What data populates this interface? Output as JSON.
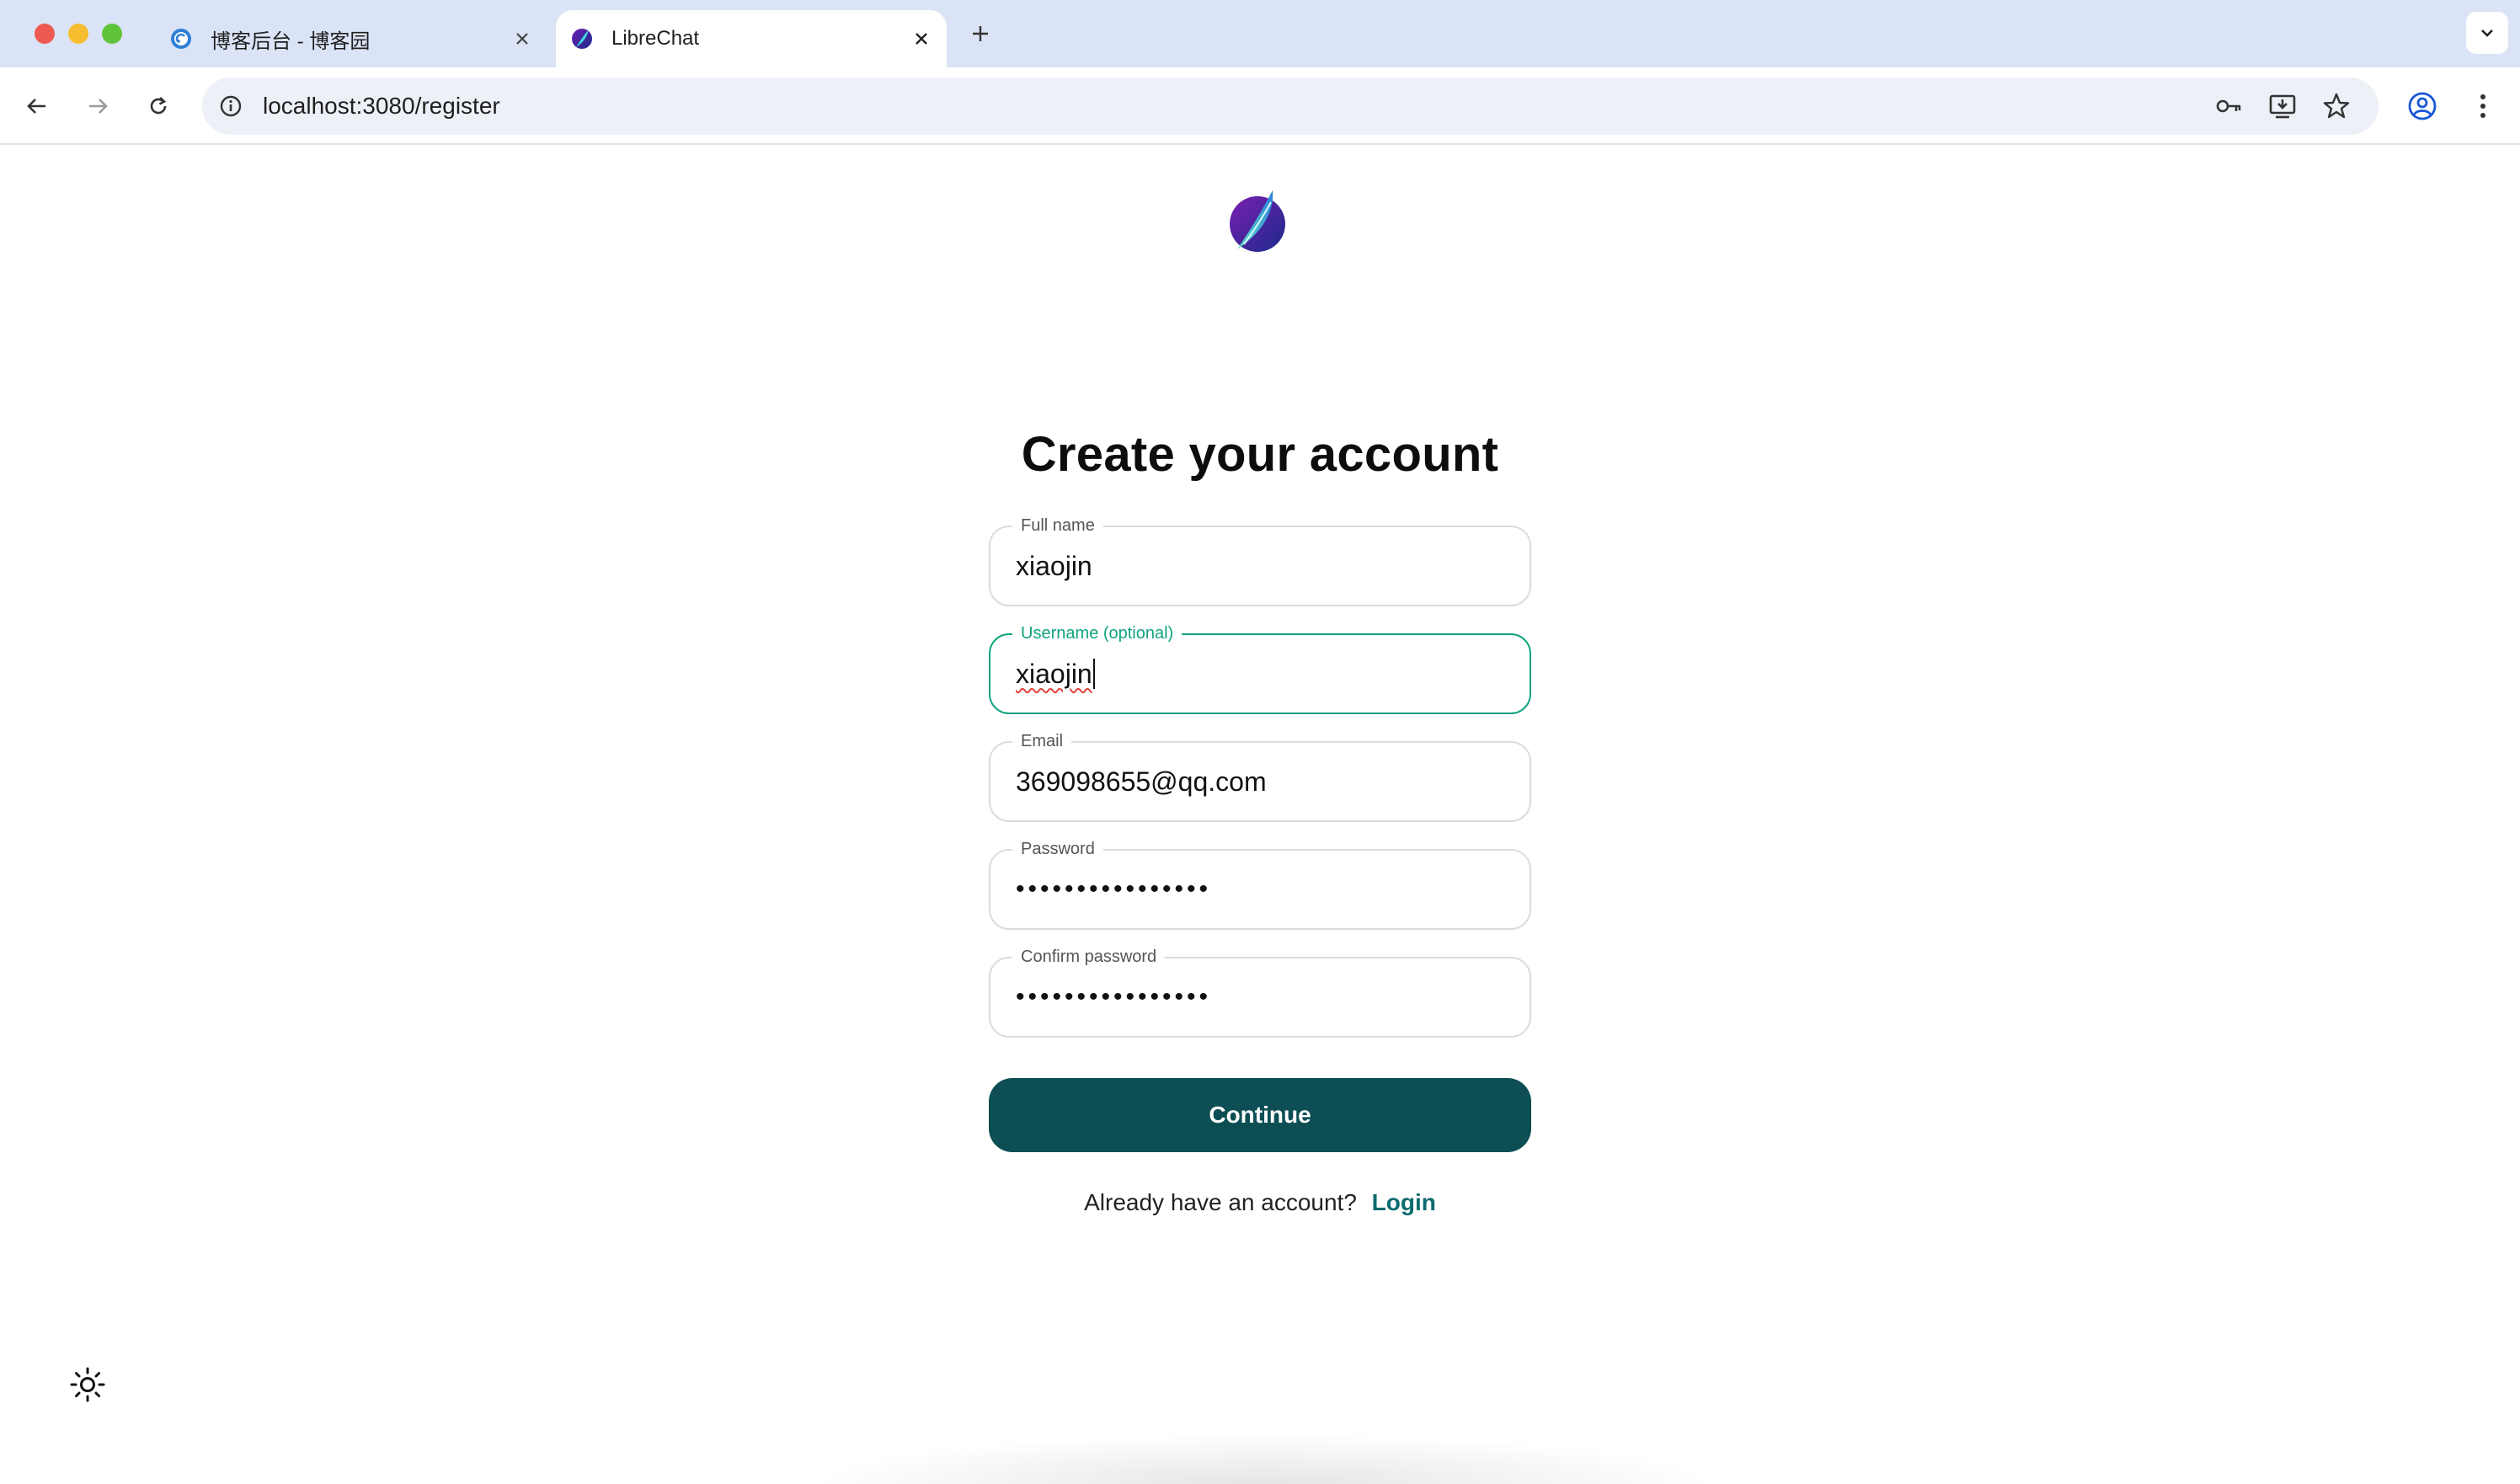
{
  "browser": {
    "tabs": [
      {
        "title": "博客后台 - 博客园",
        "favicon": "cnblogs-icon",
        "active": false
      },
      {
        "title": "LibreChat",
        "favicon": "librechat-icon",
        "active": true
      }
    ],
    "url": "localhost:3080/register"
  },
  "page": {
    "heading": "Create your account",
    "fields": {
      "full_name": {
        "label": "Full name",
        "value": "xiaojin"
      },
      "username": {
        "label": "Username (optional)",
        "value": "xiaojin"
      },
      "email": {
        "label": "Email",
        "value": "369098655@qq.com"
      },
      "password": {
        "label": "Password",
        "value": "••••••••••••••••"
      },
      "confirm_password": {
        "label": "Confirm password",
        "value": "••••••••••••••••"
      }
    },
    "continue_label": "Continue",
    "login_prompt": "Already have an account?",
    "login_link": "Login"
  },
  "colors": {
    "accent": "#10a37f",
    "button": "#0c4e54",
    "link": "#0c6b6e",
    "tabstrip": "#dbe4f6"
  }
}
